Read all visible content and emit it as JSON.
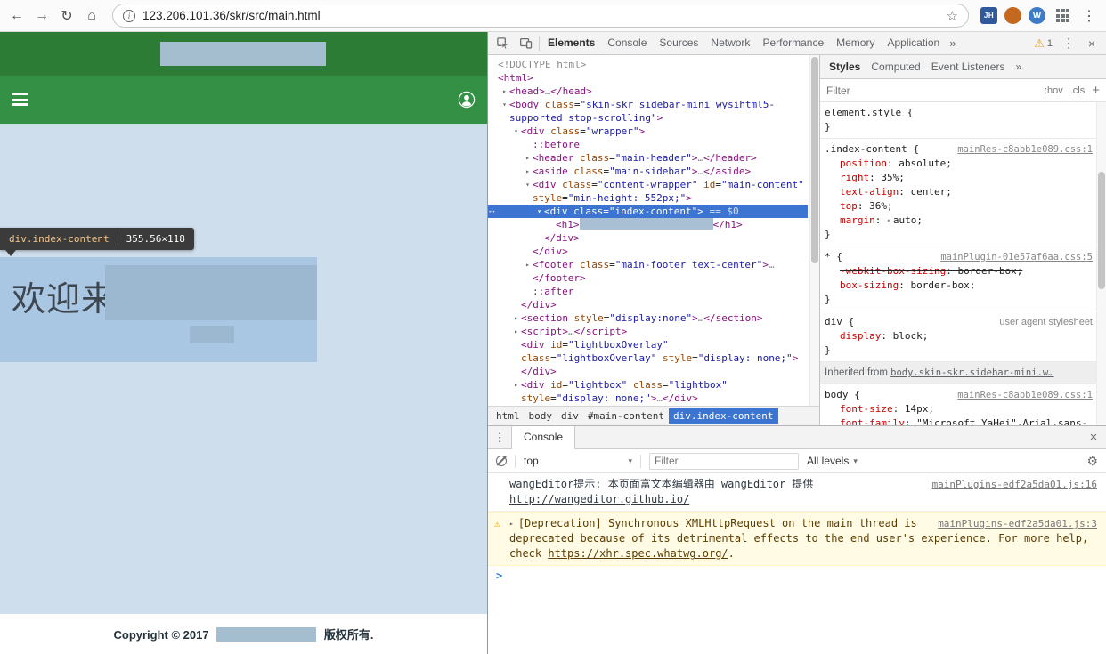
{
  "browser": {
    "url": "123.206.101.36/skr/src/main.html",
    "ext_jh": "JH",
    "ext_w": "W"
  },
  "icons": {
    "back": "←",
    "forward": "→",
    "reload": "↻",
    "home": "⌂",
    "info": "i",
    "star": "☆",
    "menu_dots": "⋮",
    "overflow": "»",
    "close": "×",
    "warning": "⚠",
    "dots": "⋯",
    "collapse": "▾",
    "expand": "▸",
    "dropdown": "▾",
    "gear": "⚙",
    "prompt": ">"
  },
  "colors": {
    "brand_green_header": "#2c7c36",
    "brand_green_nav": "#349045",
    "content_background": "#cfdeec",
    "inspect_highlight": "#a9c6e2",
    "selection_blue": "#3b75d1",
    "warning_background": "#fffbe5"
  },
  "page": {
    "welcome": "欢迎来到",
    "footer_prefix": "Copyright © 2017",
    "footer_suffix": "版权所有.",
    "tooltip": {
      "selector": "div.index-content",
      "dims": "355.56×118"
    }
  },
  "devtools": {
    "tabs": [
      "Elements",
      "Console",
      "Sources",
      "Network",
      "Performance",
      "Memory",
      "Application"
    ],
    "selected_tab": "Elements",
    "warning_count": "1",
    "breadcrumb": [
      "html",
      "body",
      "div",
      "#main-content",
      "div.index-content"
    ],
    "tree": [
      {
        "ind": 0,
        "seg": [
          [
            "g",
            "<!DOCTYPE html>"
          ]
        ]
      },
      {
        "ind": 0,
        "seg": [
          [
            "t",
            "<html>"
          ]
        ]
      },
      {
        "ind": 1,
        "arrow": "r",
        "seg": [
          [
            "t",
            "<head>"
          ],
          [
            "g",
            "…"
          ],
          [
            "t",
            "</head>"
          ]
        ]
      },
      {
        "ind": 1,
        "arrow": "d",
        "seg": [
          [
            "t",
            "<body"
          ],
          [
            "p",
            " "
          ],
          [
            "a",
            "class"
          ],
          [
            "p",
            "="
          ],
          [
            "v",
            "\"skin-skr sidebar-mini wysihtml5-supported stop-scrolling\""
          ],
          [
            "t",
            ">"
          ]
        ]
      },
      {
        "ind": 2,
        "arrow": "d",
        "seg": [
          [
            "t",
            "<div"
          ],
          [
            "p",
            " "
          ],
          [
            "a",
            "class"
          ],
          [
            "p",
            "="
          ],
          [
            "v",
            "\"wrapper\""
          ],
          [
            "t",
            ">"
          ]
        ]
      },
      {
        "ind": 3,
        "seg": [
          [
            "t",
            "::before"
          ]
        ]
      },
      {
        "ind": 3,
        "arrow": "r",
        "seg": [
          [
            "t",
            "<header"
          ],
          [
            "p",
            " "
          ],
          [
            "a",
            "class"
          ],
          [
            "p",
            "="
          ],
          [
            "v",
            "\"main-header\""
          ],
          [
            "t",
            ">"
          ],
          [
            "g",
            "…"
          ],
          [
            "t",
            "</header>"
          ]
        ]
      },
      {
        "ind": 3,
        "arrow": "r",
        "seg": [
          [
            "t",
            "<aside"
          ],
          [
            "p",
            " "
          ],
          [
            "a",
            "class"
          ],
          [
            "p",
            "="
          ],
          [
            "v",
            "\"main-sidebar\""
          ],
          [
            "t",
            ">"
          ],
          [
            "g",
            "…"
          ],
          [
            "t",
            "</aside>"
          ]
        ]
      },
      {
        "ind": 3,
        "arrow": "d",
        "seg": [
          [
            "t",
            "<div"
          ],
          [
            "p",
            " "
          ],
          [
            "a",
            "class"
          ],
          [
            "p",
            "="
          ],
          [
            "v",
            "\"content-wrapper\""
          ],
          [
            "p",
            " "
          ],
          [
            "a",
            "id"
          ],
          [
            "p",
            "="
          ],
          [
            "v",
            "\"main-content\""
          ],
          [
            "p",
            " "
          ],
          [
            "a",
            "style"
          ],
          [
            "p",
            "="
          ],
          [
            "v",
            "\"min-height: 552px;\""
          ],
          [
            "t",
            ">"
          ]
        ]
      },
      {
        "ind": 4,
        "arrow": "d",
        "sel": true,
        "dots": true,
        "seg": [
          [
            "t",
            "<div"
          ],
          [
            "p",
            " "
          ],
          [
            "a",
            "class"
          ],
          [
            "p",
            "="
          ],
          [
            "v",
            "\"index-content\""
          ],
          [
            "t",
            ">"
          ],
          [
            "d",
            " == $0"
          ]
        ]
      },
      {
        "ind": 5,
        "seg": [
          [
            "t",
            "<h1>"
          ],
          [
            "blur",
            ""
          ],
          [
            "t",
            "</h1>"
          ]
        ]
      },
      {
        "ind": 4,
        "seg": [
          [
            "t",
            "</div>"
          ]
        ]
      },
      {
        "ind": 3,
        "seg": [
          [
            "t",
            "</div>"
          ]
        ]
      },
      {
        "ind": 3,
        "arrow": "r",
        "seg": [
          [
            "t",
            "<footer"
          ],
          [
            "p",
            " "
          ],
          [
            "a",
            "class"
          ],
          [
            "p",
            "="
          ],
          [
            "v",
            "\"main-footer text-center\""
          ],
          [
            "t",
            ">"
          ],
          [
            "g",
            "…"
          ],
          [
            "t",
            "</footer>"
          ]
        ]
      },
      {
        "ind": 3,
        "seg": [
          [
            "t",
            "::after"
          ]
        ]
      },
      {
        "ind": 2,
        "seg": [
          [
            "t",
            "</div>"
          ]
        ]
      },
      {
        "ind": 2,
        "arrow": "r",
        "seg": [
          [
            "t",
            "<section"
          ],
          [
            "p",
            " "
          ],
          [
            "a",
            "style"
          ],
          [
            "p",
            "="
          ],
          [
            "v",
            "\"display:none\""
          ],
          [
            "t",
            ">"
          ],
          [
            "g",
            "…"
          ],
          [
            "t",
            "</section>"
          ]
        ]
      },
      {
        "ind": 2,
        "arrow": "r",
        "seg": [
          [
            "t",
            "<script>"
          ],
          [
            "g",
            "…"
          ],
          [
            "t",
            "</script>"
          ]
        ]
      },
      {
        "ind": 2,
        "seg": [
          [
            "t",
            "<div"
          ],
          [
            "p",
            " "
          ],
          [
            "a",
            "id"
          ],
          [
            "p",
            "="
          ],
          [
            "v",
            "\"lightboxOverlay\""
          ],
          [
            "p",
            " "
          ],
          [
            "a",
            "class"
          ],
          [
            "p",
            "="
          ],
          [
            "v",
            "\"lightboxOverlay\""
          ],
          [
            "p",
            " "
          ],
          [
            "a",
            "style"
          ],
          [
            "p",
            "="
          ],
          [
            "v",
            "\"display: none;\""
          ],
          [
            "t",
            ">"
          ]
        ]
      },
      {
        "ind": 2,
        "seg": [
          [
            "t",
            "</div>"
          ]
        ]
      },
      {
        "ind": 2,
        "arrow": "r",
        "seg": [
          [
            "t",
            "<div"
          ],
          [
            "p",
            " "
          ],
          [
            "a",
            "id"
          ],
          [
            "p",
            "="
          ],
          [
            "v",
            "\"lightbox\""
          ],
          [
            "p",
            " "
          ],
          [
            "a",
            "class"
          ],
          [
            "p",
            "="
          ],
          [
            "v",
            "\"lightbox\""
          ],
          [
            "p",
            " "
          ],
          [
            "a",
            "style"
          ],
          [
            "p",
            "="
          ],
          [
            "v",
            "\"display: none;\""
          ],
          [
            "t",
            ">"
          ],
          [
            "g",
            "…"
          ],
          [
            "t",
            "</div>"
          ]
        ]
      }
    ],
    "styles": {
      "tabs": [
        "Styles",
        "Computed",
        "Event Listeners"
      ],
      "overflow": "»",
      "filter_placeholder": "Filter",
      "pseudo_toggle": ":hov",
      "class_toggle": ".cls",
      "new_rule": "+",
      "sections": [
        {
          "type": "rule",
          "selector": "element.style",
          "link": "",
          "props": []
        },
        {
          "type": "rule",
          "selector": ".index-content",
          "link": "mainRes-c8abb1e089.css:1",
          "props": [
            {
              "name": "position",
              "value": "absolute"
            },
            {
              "name": "right",
              "value": "35%"
            },
            {
              "name": "text-align",
              "value": "center"
            },
            {
              "name": "top",
              "value": "36%"
            },
            {
              "name": "margin",
              "value": "auto",
              "expand": true
            }
          ]
        },
        {
          "type": "rule",
          "selector": "*",
          "link": "mainPlugin-01e57af6aa.css:5",
          "props": [
            {
              "name": "-webkit-box-sizing",
              "value": "border-box",
              "struck": true
            },
            {
              "name": "box-sizing",
              "value": "border-box"
            }
          ]
        },
        {
          "type": "rule",
          "selector": "div",
          "link": "user agent stylesheet",
          "plainlink": true,
          "props": [
            {
              "name": "display",
              "value": "block"
            }
          ]
        },
        {
          "type": "inherited",
          "label": "Inherited from",
          "target": "body.skin-skr.sidebar-mini.w…"
        },
        {
          "type": "rule",
          "selector": "body",
          "link": "mainRes-c8abb1e089.css:1",
          "props": [
            {
              "name": "font-size",
              "value": "14px"
            },
            {
              "name": "font-family",
              "value": "\"Microsoft YaHei\",Arial,sans-serif"
            }
          ]
        }
      ]
    },
    "console": {
      "tab_label": "Console",
      "context": "top",
      "filter_placeholder": "Filter",
      "levels_label": "All levels",
      "messages": [
        {
          "level": "log",
          "parts": [
            [
              "t",
              "wangEditor提示: 本页面富文本编辑器由 wangEditor 提供 "
            ],
            [
              "l",
              "http://wangeditor.github.io/"
            ]
          ],
          "source": "mainPlugins-edf2a5da01.js:16"
        },
        {
          "level": "warn",
          "expandable": true,
          "parts": [
            [
              "t",
              "[Deprecation] Synchronous XMLHttpRequest on the main thread is deprecated because of its detrimental effects to the end user's experience. For more help, check "
            ],
            [
              "l",
              "https://xhr.spec.whatwg.org/"
            ],
            [
              "t",
              "."
            ]
          ],
          "source": "mainPlugins-edf2a5da01.js:3"
        }
      ]
    }
  }
}
